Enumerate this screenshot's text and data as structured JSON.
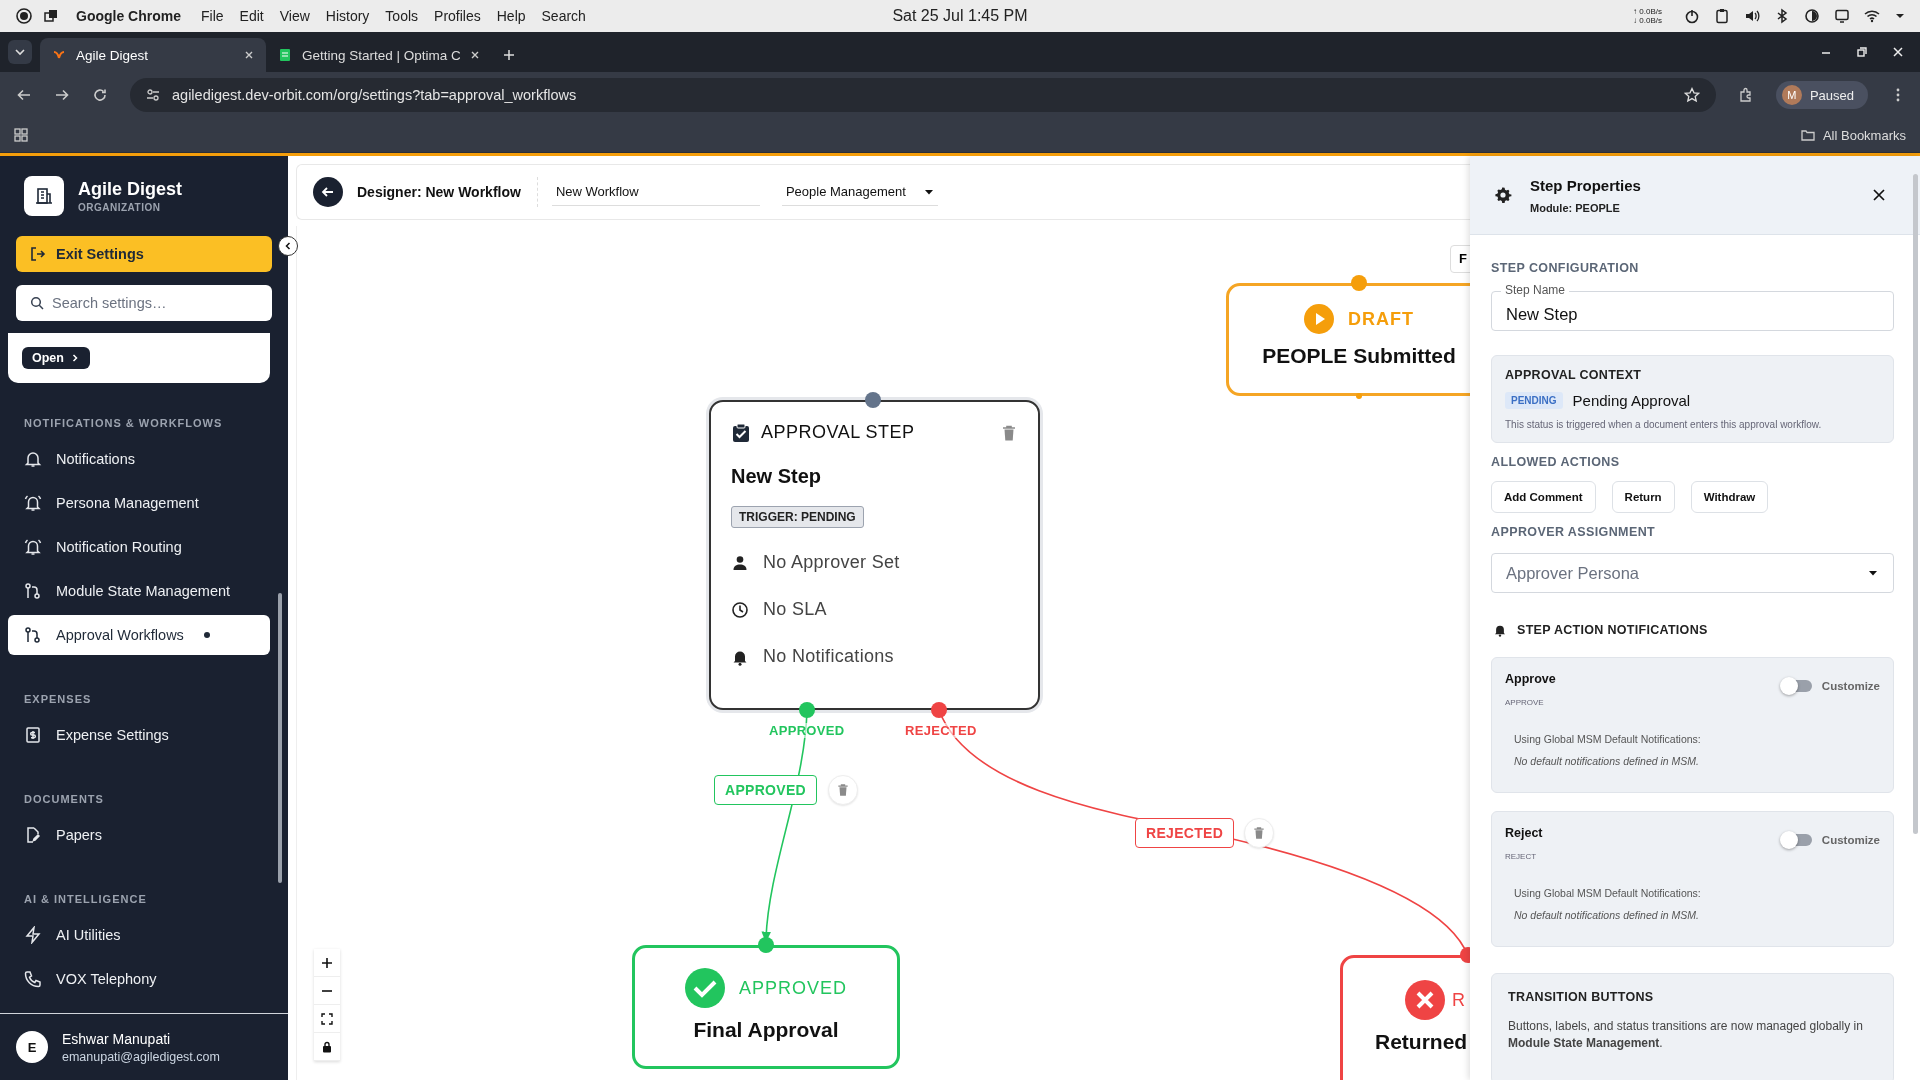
{
  "os_bar": {
    "app": "Google Chrome",
    "menus": [
      "File",
      "Edit",
      "View",
      "History",
      "Tools",
      "Profiles",
      "Help",
      "Search"
    ],
    "clock": "Sat 25 Jul 1:45 PM",
    "net_up": "↑ 0.0B/s",
    "net_down": "↓ 0.0B/s"
  },
  "browser": {
    "tabs": [
      {
        "title": "Agile Digest",
        "selected": true
      },
      {
        "title": "Getting Started | Optima C",
        "selected": false
      }
    ],
    "url": "agiledigest.dev-orbit.com/org/settings?tab=approval_workflows",
    "profile_initial": "M",
    "profile_status": "Paused",
    "bookmarks": "All Bookmarks"
  },
  "sidebar": {
    "org_name": "Agile Digest",
    "org_type": "ORGANIZATION",
    "exit_button": "Exit Settings",
    "search": {
      "placeholder": "Search settings…"
    },
    "open_button": "Open",
    "sections": [
      {
        "heading": "NOTIFICATIONS & WORKFLOWS",
        "items": [
          {
            "label": "Notifications",
            "selected": false,
            "dot": false
          },
          {
            "label": "Persona Management",
            "selected": false,
            "dot": false
          },
          {
            "label": "Notification Routing",
            "selected": false,
            "dot": false
          },
          {
            "label": "Module State Management",
            "selected": false,
            "dot": false
          },
          {
            "label": "Approval Workflows",
            "selected": true,
            "dot": true
          }
        ]
      },
      {
        "heading": "EXPENSES",
        "items": [
          {
            "label": "Expense Settings",
            "selected": false,
            "dot": false
          }
        ]
      },
      {
        "heading": "DOCUMENTS",
        "items": [
          {
            "label": "Papers",
            "selected": false,
            "dot": false
          }
        ]
      },
      {
        "heading": "AI & INTELLIGENCE",
        "items": [
          {
            "label": "AI Utilities",
            "selected": false,
            "dot": false
          },
          {
            "label": "VOX Telephony",
            "selected": false,
            "dot": false
          }
        ]
      }
    ],
    "user": {
      "initial": "E",
      "name": "Eshwar Manupati",
      "email": "emanupati@agiledigest.com"
    }
  },
  "designer": {
    "title": "Designer: New Workflow",
    "workflow_name": "New Workflow",
    "module": "People Management",
    "corner_button": "F",
    "nodes": [
      {
        "kind": "start",
        "heading": "DRAFT",
        "title": "PEOPLE Submitted"
      },
      {
        "kind": "approval",
        "heading": "APPROVAL STEP",
        "title": "New Step",
        "trigger": "TRIGGER: PENDING",
        "fields": [
          "No Approver Set",
          "No SLA",
          "No Notifications"
        ],
        "outputs": [
          "APPROVED",
          "REJECTED"
        ]
      },
      {
        "kind": "approved",
        "heading": "APPROVED",
        "title": "Final Approval"
      },
      {
        "kind": "rejected",
        "heading": "R",
        "title": "Returned"
      }
    ],
    "edges": [
      {
        "kind": "approved",
        "label": "APPROVED"
      },
      {
        "kind": "rejected",
        "label": "REJECTED"
      }
    ]
  },
  "panel": {
    "title": "Step Properties",
    "subtitle": "Module: PEOPLE",
    "config_heading": "STEP CONFIGURATION",
    "step_name_label": "Step Name",
    "step_name": "New Step",
    "context": {
      "heading": "APPROVAL CONTEXT",
      "badge": "PENDING",
      "status": "Pending Approval",
      "note": "This status is triggered when a document enters this approval workflow."
    },
    "actions_heading": "ALLOWED ACTIONS",
    "actions": [
      "Add Comment",
      "Return",
      "Withdraw"
    ],
    "assignment_heading": "APPROVER ASSIGNMENT",
    "approver_select": {
      "placeholder": "Approver Persona"
    },
    "notifications_heading": "STEP ACTION NOTIFICATIONS",
    "notification_cards": [
      {
        "title": "Approve",
        "code": "APPROVE",
        "toggle_label": "Customize",
        "on": false,
        "info": "Using Global MSM Default Notifications:",
        "empty": "No default notifications defined in MSM."
      },
      {
        "title": "Reject",
        "code": "REJECT",
        "toggle_label": "Customize",
        "on": false,
        "info": "Using Global MSM Default Notifications:",
        "empty": "No default notifications defined in MSM."
      }
    ],
    "transition": {
      "heading": "TRANSITION BUTTONS",
      "text": "Buttons, labels, and status transitions are now managed globally in **Module State Management**."
    }
  }
}
